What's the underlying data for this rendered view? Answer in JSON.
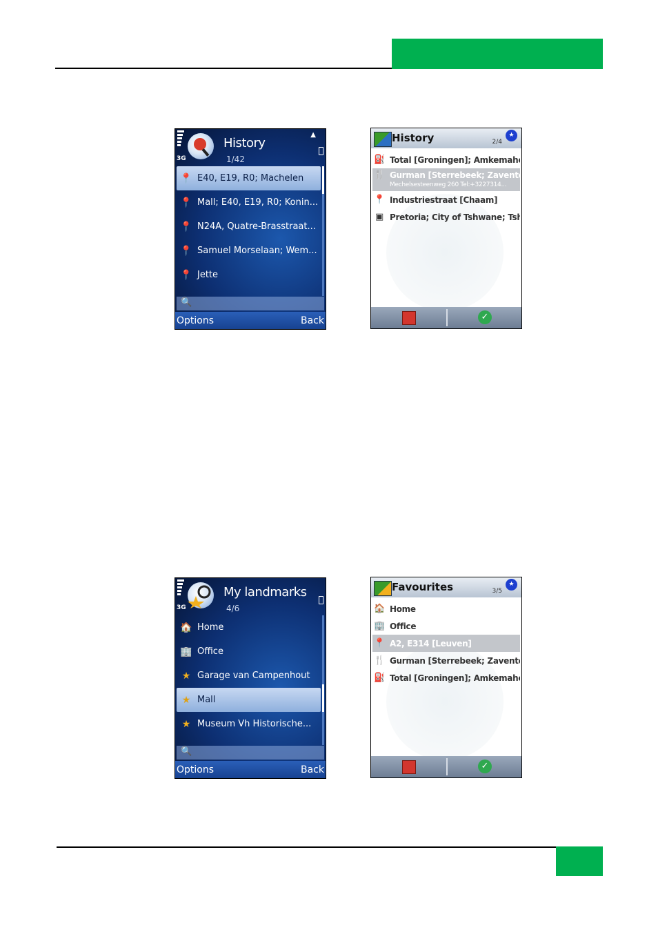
{
  "history_s60": {
    "title": "History",
    "count": "1/42",
    "network": "3G",
    "items": [
      {
        "label": "E40, E19, R0; Machelen",
        "selected": true
      },
      {
        "label": "Mall; E40, E19, R0; Konin..."
      },
      {
        "label": "N24A, Quatre-Brasstraat..."
      },
      {
        "label": "Samuel Morselaan; Wem..."
      },
      {
        "label": "Jette"
      }
    ],
    "left_soft": "Options",
    "right_soft": "Back"
  },
  "history_custom": {
    "title": "History",
    "count": "2/4",
    "items": [
      {
        "label": "Total [Groningen]; Amkemaheerd"
      },
      {
        "label": "Gurman [Sterrebeek; Zaventem]",
        "sub": "Mechelsesteenweg 260 Tel:+3227314...",
        "selected": true
      },
      {
        "label": "Industriestraat [Chaam]"
      },
      {
        "label": "Pretoria; City of Tshwane; Tshwa"
      }
    ]
  },
  "landmarks_s60": {
    "title": "My landmarks",
    "count": "4/6",
    "network": "3G",
    "items": [
      {
        "label": "Home"
      },
      {
        "label": "Office"
      },
      {
        "label": "Garage van Campenhout"
      },
      {
        "label": "Mall",
        "selected": true
      },
      {
        "label": "Museum Vh Historische..."
      }
    ],
    "left_soft": "Options",
    "right_soft": "Back"
  },
  "favourites_custom": {
    "title": "Favourites",
    "count": "3/5",
    "items": [
      {
        "label": "Home"
      },
      {
        "label": "Office"
      },
      {
        "label": "A2, E314 [Leuven]",
        "selected": true
      },
      {
        "label": "Gurman [Sterrebeek; Zaventem];"
      },
      {
        "label": "Total [Groningen]; Amkemaheerd"
      }
    ]
  },
  "colors": {
    "accent_green": "#00b050",
    "s60_blue": "#0d2f72"
  }
}
